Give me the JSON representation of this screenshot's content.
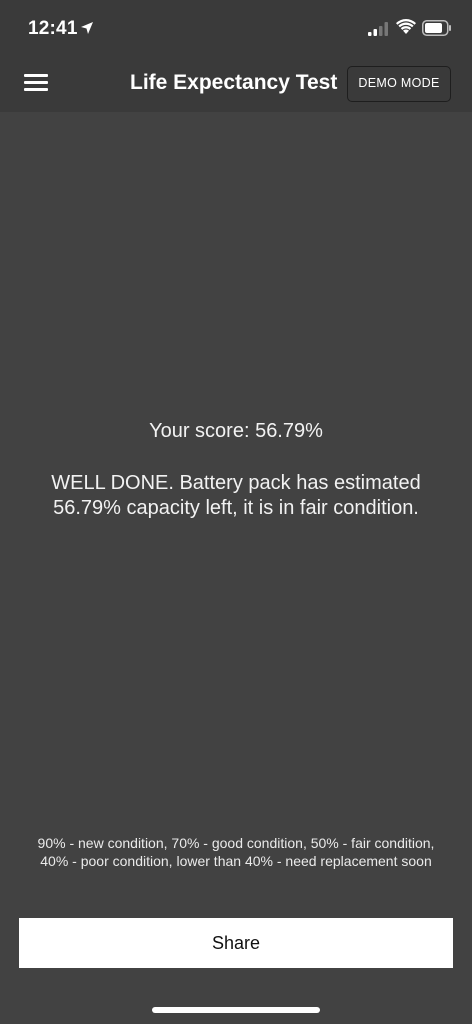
{
  "status_bar": {
    "time": "12:41",
    "icons": [
      "location-arrow-icon",
      "cellular-signal-icon",
      "wifi-icon",
      "battery-icon"
    ]
  },
  "nav": {
    "title": "Life Expectancy Test",
    "demo_label": "DEMO MODE",
    "menu_icon": "hamburger-menu-icon"
  },
  "result": {
    "score_text": "Your score: 56.79%",
    "message": "WELL DONE. Battery pack has estimated 56.79% capacity left, it is in fair condition."
  },
  "legend_text": "90% - new condition, 70% - good condition, 50% - fair condition, 40% - poor condition, lower than 40% - need replacement soon",
  "share_label": "Share",
  "colors": {
    "background": "#424242",
    "header": "#3a3a3a",
    "button_bg": "#ffffff",
    "text": "#ffffff"
  }
}
